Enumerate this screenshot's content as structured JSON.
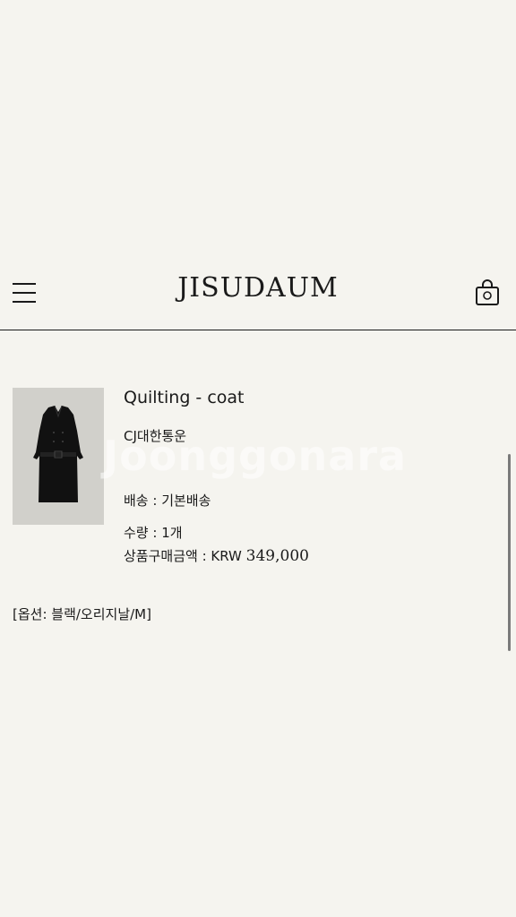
{
  "header": {
    "logo": "JISUDAUM",
    "menu_icon": "hamburger-menu-icon",
    "bag_icon": "shopping-bag-icon"
  },
  "product": {
    "name": "Quilting - coat",
    "carrier": "CJ대한통운",
    "shipping_label": "배송 : 기본배송",
    "quantity_label": "수량 : 1개",
    "amount_label": "상품구매금액 : KRW ",
    "amount_value": "349,000",
    "options": "[옵션: 블랙/오리지날/M]"
  },
  "watermark": "Joonggonara",
  "colors": {
    "background": "#f5f4ef",
    "text": "#1a1a1a",
    "thumbnail_bg": "#d1d0cb"
  }
}
